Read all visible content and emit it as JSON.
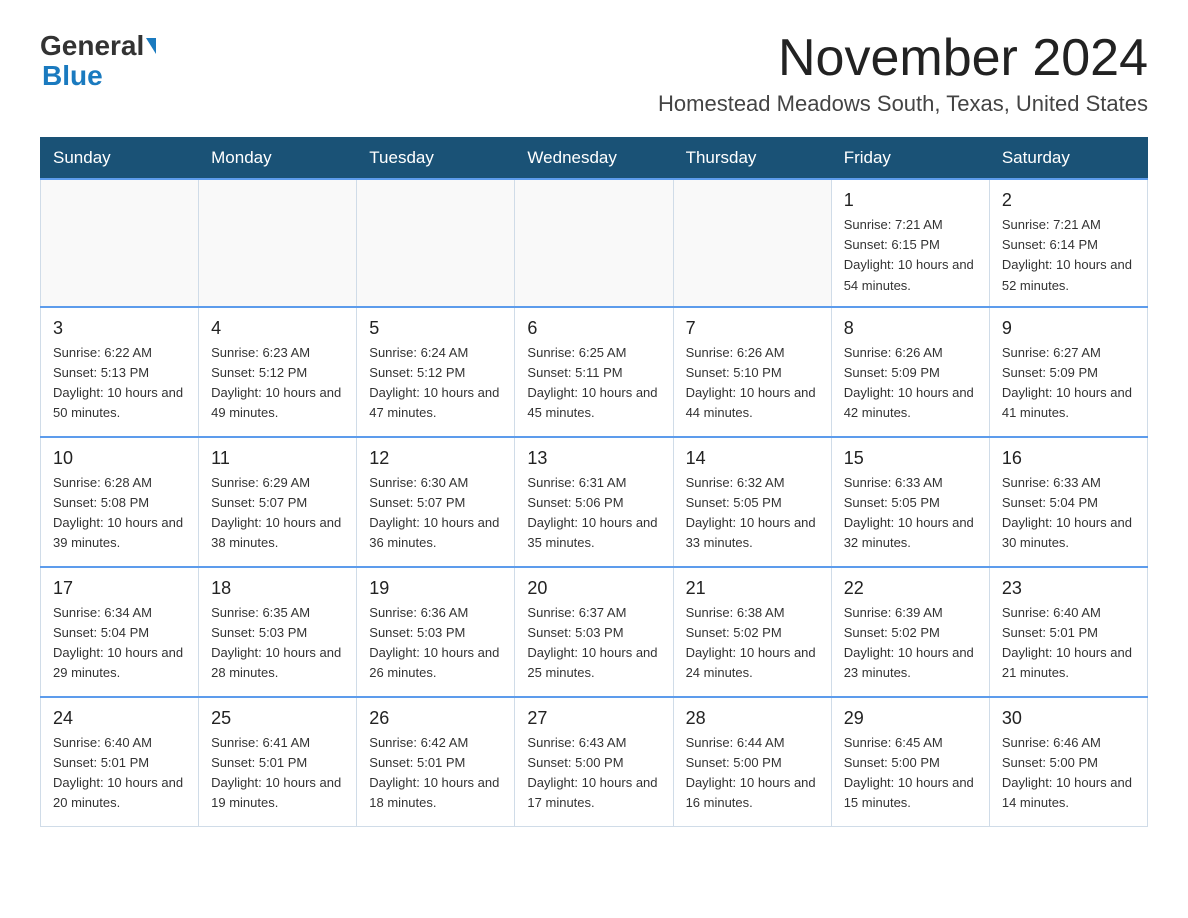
{
  "logo": {
    "general": "General",
    "blue": "Blue"
  },
  "title": {
    "month": "November 2024",
    "location": "Homestead Meadows South, Texas, United States"
  },
  "weekdays": [
    "Sunday",
    "Monday",
    "Tuesday",
    "Wednesday",
    "Thursday",
    "Friday",
    "Saturday"
  ],
  "weeks": [
    [
      {
        "day": "",
        "info": ""
      },
      {
        "day": "",
        "info": ""
      },
      {
        "day": "",
        "info": ""
      },
      {
        "day": "",
        "info": ""
      },
      {
        "day": "",
        "info": ""
      },
      {
        "day": "1",
        "info": "Sunrise: 7:21 AM\nSunset: 6:15 PM\nDaylight: 10 hours and 54 minutes."
      },
      {
        "day": "2",
        "info": "Sunrise: 7:21 AM\nSunset: 6:14 PM\nDaylight: 10 hours and 52 minutes."
      }
    ],
    [
      {
        "day": "3",
        "info": "Sunrise: 6:22 AM\nSunset: 5:13 PM\nDaylight: 10 hours and 50 minutes."
      },
      {
        "day": "4",
        "info": "Sunrise: 6:23 AM\nSunset: 5:12 PM\nDaylight: 10 hours and 49 minutes."
      },
      {
        "day": "5",
        "info": "Sunrise: 6:24 AM\nSunset: 5:12 PM\nDaylight: 10 hours and 47 minutes."
      },
      {
        "day": "6",
        "info": "Sunrise: 6:25 AM\nSunset: 5:11 PM\nDaylight: 10 hours and 45 minutes."
      },
      {
        "day": "7",
        "info": "Sunrise: 6:26 AM\nSunset: 5:10 PM\nDaylight: 10 hours and 44 minutes."
      },
      {
        "day": "8",
        "info": "Sunrise: 6:26 AM\nSunset: 5:09 PM\nDaylight: 10 hours and 42 minutes."
      },
      {
        "day": "9",
        "info": "Sunrise: 6:27 AM\nSunset: 5:09 PM\nDaylight: 10 hours and 41 minutes."
      }
    ],
    [
      {
        "day": "10",
        "info": "Sunrise: 6:28 AM\nSunset: 5:08 PM\nDaylight: 10 hours and 39 minutes."
      },
      {
        "day": "11",
        "info": "Sunrise: 6:29 AM\nSunset: 5:07 PM\nDaylight: 10 hours and 38 minutes."
      },
      {
        "day": "12",
        "info": "Sunrise: 6:30 AM\nSunset: 5:07 PM\nDaylight: 10 hours and 36 minutes."
      },
      {
        "day": "13",
        "info": "Sunrise: 6:31 AM\nSunset: 5:06 PM\nDaylight: 10 hours and 35 minutes."
      },
      {
        "day": "14",
        "info": "Sunrise: 6:32 AM\nSunset: 5:05 PM\nDaylight: 10 hours and 33 minutes."
      },
      {
        "day": "15",
        "info": "Sunrise: 6:33 AM\nSunset: 5:05 PM\nDaylight: 10 hours and 32 minutes."
      },
      {
        "day": "16",
        "info": "Sunrise: 6:33 AM\nSunset: 5:04 PM\nDaylight: 10 hours and 30 minutes."
      }
    ],
    [
      {
        "day": "17",
        "info": "Sunrise: 6:34 AM\nSunset: 5:04 PM\nDaylight: 10 hours and 29 minutes."
      },
      {
        "day": "18",
        "info": "Sunrise: 6:35 AM\nSunset: 5:03 PM\nDaylight: 10 hours and 28 minutes."
      },
      {
        "day": "19",
        "info": "Sunrise: 6:36 AM\nSunset: 5:03 PM\nDaylight: 10 hours and 26 minutes."
      },
      {
        "day": "20",
        "info": "Sunrise: 6:37 AM\nSunset: 5:03 PM\nDaylight: 10 hours and 25 minutes."
      },
      {
        "day": "21",
        "info": "Sunrise: 6:38 AM\nSunset: 5:02 PM\nDaylight: 10 hours and 24 minutes."
      },
      {
        "day": "22",
        "info": "Sunrise: 6:39 AM\nSunset: 5:02 PM\nDaylight: 10 hours and 23 minutes."
      },
      {
        "day": "23",
        "info": "Sunrise: 6:40 AM\nSunset: 5:01 PM\nDaylight: 10 hours and 21 minutes."
      }
    ],
    [
      {
        "day": "24",
        "info": "Sunrise: 6:40 AM\nSunset: 5:01 PM\nDaylight: 10 hours and 20 minutes."
      },
      {
        "day": "25",
        "info": "Sunrise: 6:41 AM\nSunset: 5:01 PM\nDaylight: 10 hours and 19 minutes."
      },
      {
        "day": "26",
        "info": "Sunrise: 6:42 AM\nSunset: 5:01 PM\nDaylight: 10 hours and 18 minutes."
      },
      {
        "day": "27",
        "info": "Sunrise: 6:43 AM\nSunset: 5:00 PM\nDaylight: 10 hours and 17 minutes."
      },
      {
        "day": "28",
        "info": "Sunrise: 6:44 AM\nSunset: 5:00 PM\nDaylight: 10 hours and 16 minutes."
      },
      {
        "day": "29",
        "info": "Sunrise: 6:45 AM\nSunset: 5:00 PM\nDaylight: 10 hours and 15 minutes."
      },
      {
        "day": "30",
        "info": "Sunrise: 6:46 AM\nSunset: 5:00 PM\nDaylight: 10 hours and 14 minutes."
      }
    ]
  ]
}
